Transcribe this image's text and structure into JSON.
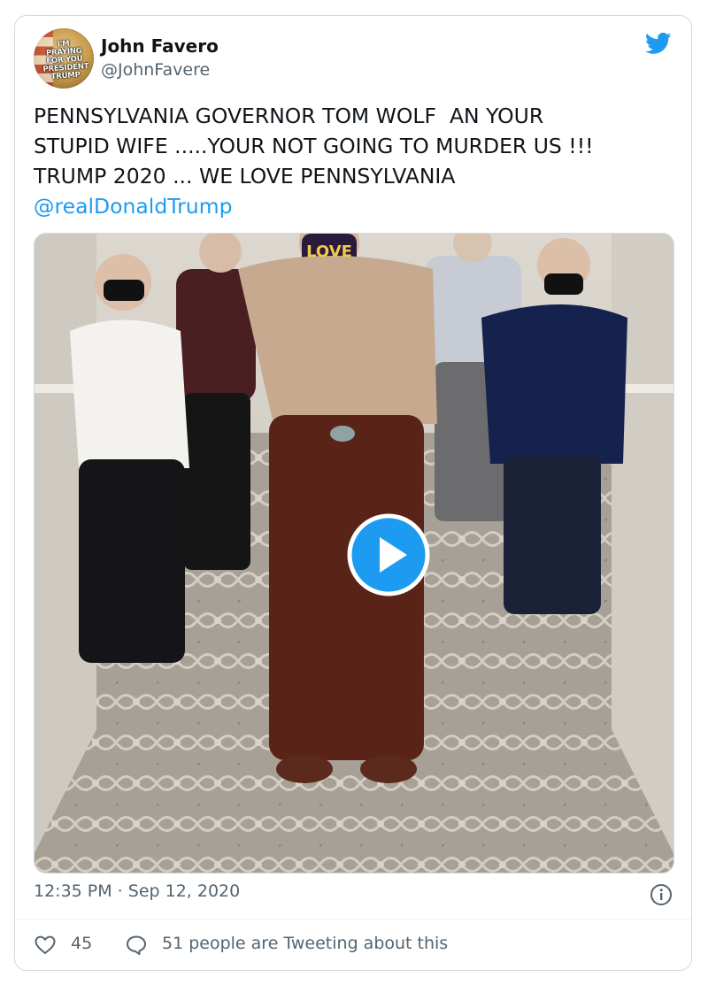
{
  "author": {
    "name": "John Favero",
    "handle": "@JohnFavere",
    "avatar_text": "I'M PRAYING FOR YOU PRESIDENT TRUMP"
  },
  "tweet": {
    "text": "PENNSYLVANIA GOVERNOR TOM WOLF  AN YOUR\nSTUPID WIFE .....YOUR NOT GOING TO MURDER US !!!\nTRUMP 2020 ... WE LOVE PENNSYLVANIA\n",
    "mention": "@realDonaldTrump",
    "mask_text": "LOVE"
  },
  "meta": {
    "timestamp": "12:35 PM · Sep 12, 2020"
  },
  "engagement": {
    "likes": "45",
    "tweeting": "51 people are Tweeting about this"
  },
  "colors": {
    "accent": "#1d9bf0",
    "secondary_text": "#536471",
    "border": "#cfd9de"
  },
  "icons": {
    "logo": "twitter-bird-icon",
    "play": "play-icon",
    "info": "info-icon",
    "like": "heart-icon",
    "reply": "speech-bubble-icon"
  }
}
